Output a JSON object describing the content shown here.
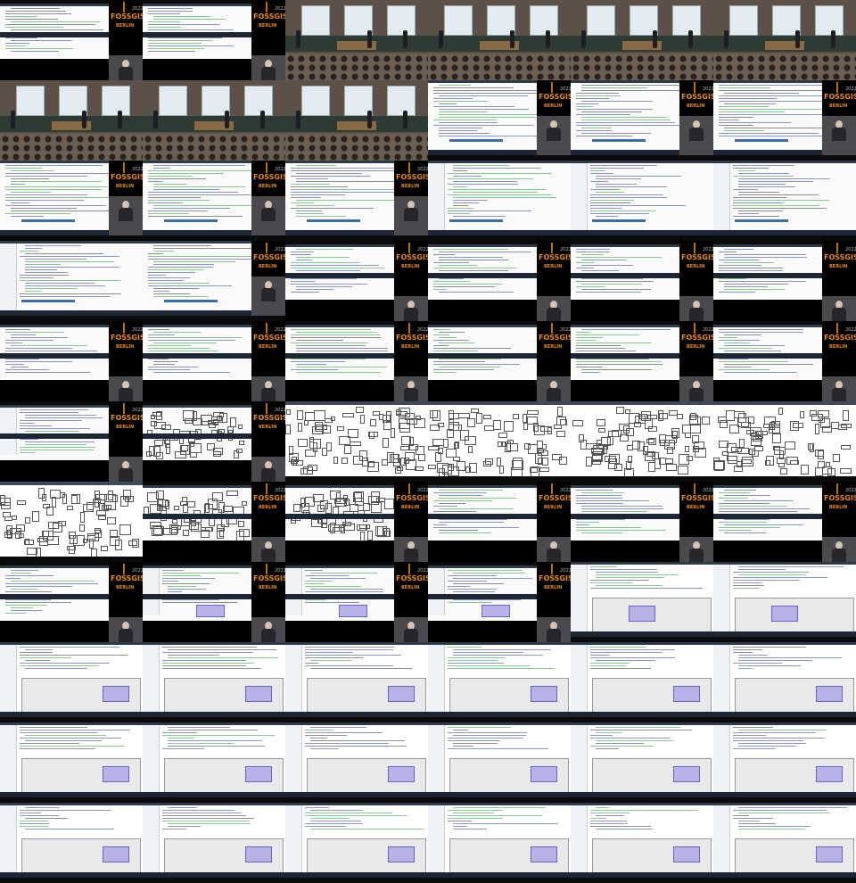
{
  "sheet": {
    "columns": 6,
    "rows": 11,
    "tile_width": 160,
    "tile_height": 90
  },
  "branding": {
    "event_name": "FOSSGIS",
    "city": "BERLIN",
    "year": "2022",
    "accent_color": "#e98a1b"
  },
  "tiles": [
    "code",
    "code",
    "hall",
    "hall",
    "hall",
    "hall",
    "hall",
    "hall",
    "hall",
    "codebig",
    "codebig",
    "codebig",
    "codebig",
    "codebig",
    "codebig",
    "ide",
    "ide",
    "ide",
    "ide",
    "codebig",
    "code",
    "code",
    "code",
    "code",
    "code",
    "code",
    "code",
    "code",
    "code",
    "code",
    "table",
    "map",
    "mapwide",
    "mapwide",
    "mapwide",
    "mapwide",
    "mapfull",
    "map",
    "map",
    "code",
    "code",
    "code",
    "code",
    "ideqgis",
    "ideqgis",
    "ideqgis",
    "qgiswide",
    "qgiswide",
    "qgis",
    "qgis",
    "qgis",
    "qgis",
    "qgis",
    "qgis",
    "qgis",
    "qgis",
    "qgis",
    "qgis",
    "qgis",
    "qgis",
    "qgis",
    "qgis",
    "qgis",
    "qgis",
    "qgis",
    "qgis"
  ]
}
